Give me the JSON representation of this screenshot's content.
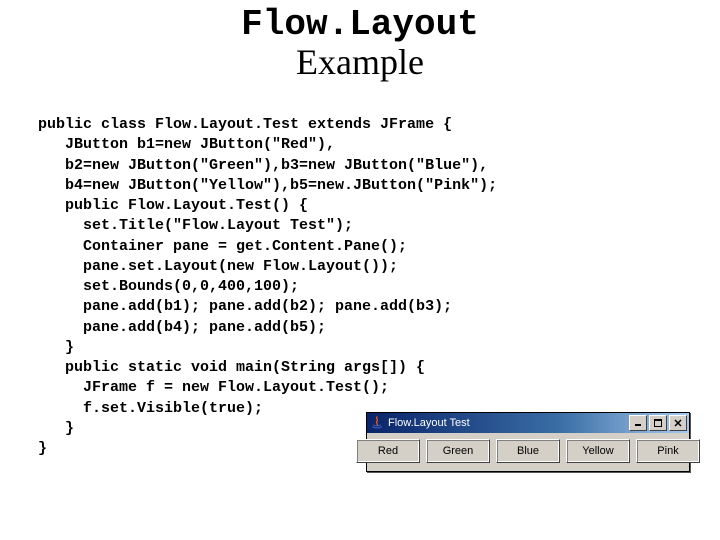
{
  "title": {
    "line1": "Flow.Layout",
    "line2": "Example"
  },
  "code_lines": [
    "public class Flow.Layout.Test extends JFrame {",
    "   JButton b1=new JButton(\"Red\"),",
    "   b2=new JButton(\"Green\"),b3=new JButton(\"Blue\"),",
    "   b4=new JButton(\"Yellow\"),b5=new.JButton(\"Pink\");",
    "   public Flow.Layout.Test() {",
    "     set.Title(\"Flow.Layout Test\");",
    "     Container pane = get.Content.Pane();",
    "     pane.set.Layout(new Flow.Layout());",
    "     set.Bounds(0,0,400,100);",
    "     pane.add(b1); pane.add(b2); pane.add(b3);",
    "     pane.add(b4); pane.add(b5);",
    "   }",
    "   public static void main(String args[]) {",
    "     JFrame f = new Flow.Layout.Test();",
    "     f.set.Visible(true);",
    "   }",
    "}"
  ],
  "code_text": "public class Flow.Layout.Test extends JFrame {\n   JButton b1=new JButton(\"Red\"),\n   b2=new JButton(\"Green\"),b3=new JButton(\"Blue\"),\n   b4=new JButton(\"Yellow\"),b5=new.JButton(\"Pink\");\n   public Flow.Layout.Test() {\n     set.Title(\"Flow.Layout Test\");\n     Container pane = get.Content.Pane();\n     pane.set.Layout(new Flow.Layout());\n     set.Bounds(0,0,400,100);\n     pane.add(b1); pane.add(b2); pane.add(b3);\n     pane.add(b4); pane.add(b5);\n   }\n   public static void main(String args[]) {\n     JFrame f = new Flow.Layout.Test();\n     f.set.Visible(true);\n   }\n}",
  "window": {
    "title": "Flow.Layout Test",
    "buttons": [
      "Red",
      "Green",
      "Blue",
      "Yellow",
      "Pink"
    ]
  }
}
